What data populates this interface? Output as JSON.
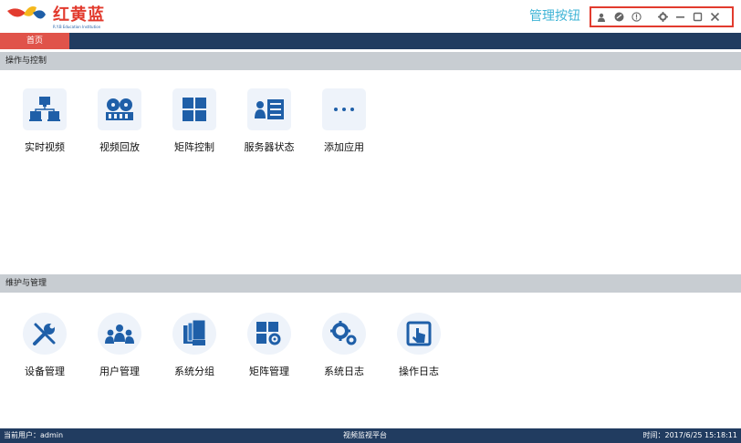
{
  "app": {
    "logo_name": "红黄蓝",
    "logo_sub": "R.Y.B Education Institution",
    "management_label": "管理按钮"
  },
  "window_controls": [
    {
      "name": "user-icon"
    },
    {
      "name": "skin-icon"
    },
    {
      "name": "info-icon"
    },
    {
      "name": "settings-icon"
    },
    {
      "name": "minimize-icon"
    },
    {
      "name": "maximize-icon"
    },
    {
      "name": "close-icon"
    }
  ],
  "tabs": [
    {
      "label": "首页",
      "active": true
    }
  ],
  "sections": [
    {
      "title": "操作与控制",
      "items": [
        {
          "label": "实时视频",
          "icon": "monitor-network-icon"
        },
        {
          "label": "视频回放",
          "icon": "film-reel-icon"
        },
        {
          "label": "矩阵控制",
          "icon": "matrix-grid-icon"
        },
        {
          "label": "服务器状态",
          "icon": "server-status-icon"
        },
        {
          "label": "添加应用",
          "icon": "more-dots-icon"
        }
      ]
    },
    {
      "title": "维护与管理",
      "items": [
        {
          "label": "设备管理",
          "icon": "tools-icon"
        },
        {
          "label": "用户管理",
          "icon": "users-icon"
        },
        {
          "label": "系统分组",
          "icon": "documents-icon"
        },
        {
          "label": "矩阵管理",
          "icon": "matrix-settings-icon"
        },
        {
          "label": "系统日志",
          "icon": "gears-icon"
        },
        {
          "label": "操作日志",
          "icon": "touch-log-icon"
        }
      ]
    }
  ],
  "status": {
    "user": "当前用户：admin",
    "center": "视频监视平台",
    "time": "时间：2017/6/25 15:18:11"
  },
  "colors": {
    "navy": "#213c60",
    "active_tab": "#e0534a",
    "icon_blue": "#1f5fa8",
    "highlight_red": "#e23b2e",
    "section_gray": "#c8cdd2"
  }
}
